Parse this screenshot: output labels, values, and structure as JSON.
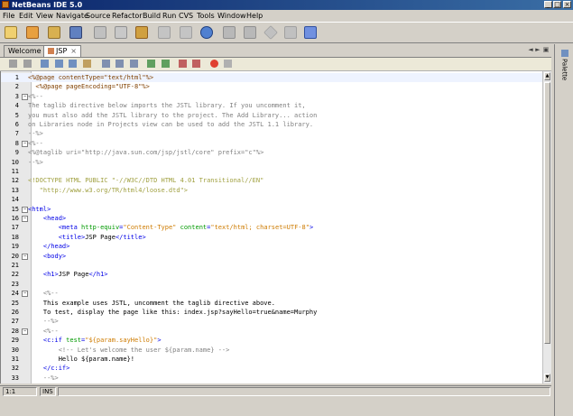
{
  "window": {
    "title": "NetBeans IDE 5.0",
    "min": "_",
    "max": "□",
    "close": "×"
  },
  "menu": [
    "File",
    "Edit",
    "View",
    "Navigate",
    "Source",
    "Refactor",
    "Build",
    "Run",
    "CVS",
    "Tools",
    "Window",
    "Help"
  ],
  "toolbar_icons": [
    {
      "name": "new-file-icon",
      "color": "#e8c060"
    },
    {
      "name": "new-project-icon",
      "color": "#e8a040"
    },
    {
      "name": "open-project-icon",
      "color": "#d8b050"
    },
    {
      "name": "save-all-icon",
      "color": "#6080c0"
    },
    {
      "name": "cut-icon",
      "color": "#a0a0a0"
    },
    {
      "name": "copy-icon",
      "color": "#a0a0a0"
    },
    {
      "name": "paste-icon",
      "color": "#d0a040"
    },
    {
      "name": "undo-icon",
      "color": "#b0b0b0"
    },
    {
      "name": "redo-icon",
      "color": "#b0b0b0"
    },
    {
      "name": "find-icon",
      "color": "#4070c0"
    },
    {
      "name": "build-icon",
      "color": "#a0a0a0"
    },
    {
      "name": "clean-build-icon",
      "color": "#a0a0a0"
    },
    {
      "name": "run-icon",
      "color": "#b0b0b0"
    },
    {
      "name": "debug-icon",
      "color": "#b0b0b0"
    },
    {
      "name": "run-file-icon",
      "color": "#6080e0"
    }
  ],
  "tabs": [
    {
      "label": "Welcome",
      "active": false
    },
    {
      "label": "JSP",
      "active": true
    }
  ],
  "right_panel": {
    "label": "Palette"
  },
  "code_lines": [
    {
      "n": "1",
      "fold": "",
      "segments": [
        {
          "c": "c-directive",
          "t": "<%@page contentType=\"text/html\"%>"
        }
      ]
    },
    {
      "n": "2",
      "fold": "",
      "segments": [
        {
          "c": "c-directive",
          "t": "  <%@page pageEncoding=\"UTF-8\"%>"
        }
      ]
    },
    {
      "n": "3",
      "fold": "−",
      "segments": [
        {
          "c": "c-comment",
          "t": "<%--"
        }
      ]
    },
    {
      "n": "4",
      "fold": "",
      "segments": [
        {
          "c": "c-comment",
          "t": "The taglib directive below imports the JSTL library. If you uncomment it,"
        }
      ]
    },
    {
      "n": "5",
      "fold": "",
      "segments": [
        {
          "c": "c-comment",
          "t": "you must also add the JSTL library to the project. The Add Library... action"
        }
      ]
    },
    {
      "n": "6",
      "fold": "",
      "segments": [
        {
          "c": "c-comment",
          "t": "on Libraries node in Projects view can be used to add the JSTL 1.1 library."
        }
      ]
    },
    {
      "n": "7",
      "fold": "",
      "segments": [
        {
          "c": "c-comment",
          "t": "--%>"
        }
      ]
    },
    {
      "n": "8",
      "fold": "−",
      "segments": [
        {
          "c": "c-comment",
          "t": "<%--"
        }
      ]
    },
    {
      "n": "9",
      "fold": "",
      "segments": [
        {
          "c": "c-comment",
          "t": "<%@taglib uri=\"http://java.sun.com/jsp/jstl/core\" prefix=\"c\"%>"
        }
      ]
    },
    {
      "n": "10",
      "fold": "",
      "segments": [
        {
          "c": "c-comment",
          "t": "--%>"
        }
      ]
    },
    {
      "n": "11",
      "fold": "",
      "segments": [
        {
          "c": "c-text",
          "t": ""
        }
      ]
    },
    {
      "n": "12",
      "fold": "",
      "segments": [
        {
          "c": "c-doctype",
          "t": "<!DOCTYPE HTML PUBLIC \"-//W3C//DTD HTML 4.01 Transitional//EN\""
        }
      ]
    },
    {
      "n": "13",
      "fold": "",
      "segments": [
        {
          "c": "c-doctype",
          "t": "   \"http://www.w3.org/TR/html4/loose.dtd\">"
        }
      ]
    },
    {
      "n": "14",
      "fold": "",
      "segments": [
        {
          "c": "c-text",
          "t": ""
        }
      ]
    },
    {
      "n": "15",
      "fold": "−",
      "segments": [
        {
          "c": "c-tag",
          "t": "<html>"
        }
      ]
    },
    {
      "n": "16",
      "fold": "−",
      "segments": [
        {
          "c": "c-tag",
          "t": "    <head>"
        }
      ]
    },
    {
      "n": "17",
      "fold": "",
      "segments": [
        {
          "c": "c-tag",
          "t": "        <meta "
        },
        {
          "c": "c-attr",
          "t": "http-equiv"
        },
        {
          "c": "c-tag",
          "t": "="
        },
        {
          "c": "c-string",
          "t": "\"Content-Type\""
        },
        {
          "c": "c-tag",
          "t": " "
        },
        {
          "c": "c-attr",
          "t": "content"
        },
        {
          "c": "c-tag",
          "t": "="
        },
        {
          "c": "c-string",
          "t": "\"text/html; charset=UTF-8\""
        },
        {
          "c": "c-tag",
          "t": ">"
        }
      ]
    },
    {
      "n": "18",
      "fold": "",
      "segments": [
        {
          "c": "c-tag",
          "t": "        <title>"
        },
        {
          "c": "c-text",
          "t": "JSP Page"
        },
        {
          "c": "c-tag",
          "t": "</title>"
        }
      ]
    },
    {
      "n": "19",
      "fold": "",
      "segments": [
        {
          "c": "c-tag",
          "t": "    </head>"
        }
      ]
    },
    {
      "n": "20",
      "fold": "−",
      "segments": [
        {
          "c": "c-tag",
          "t": "    <body>"
        }
      ]
    },
    {
      "n": "21",
      "fold": "",
      "segments": [
        {
          "c": "c-text",
          "t": ""
        }
      ]
    },
    {
      "n": "22",
      "fold": "",
      "segments": [
        {
          "c": "c-tag",
          "t": "    <h1>"
        },
        {
          "c": "c-text",
          "t": "JSP Page"
        },
        {
          "c": "c-tag",
          "t": "</h1>"
        }
      ]
    },
    {
      "n": "23",
      "fold": "",
      "segments": [
        {
          "c": "c-text",
          "t": ""
        }
      ]
    },
    {
      "n": "24",
      "fold": "−",
      "segments": [
        {
          "c": "c-comment",
          "t": "    <%--"
        }
      ]
    },
    {
      "n": "25",
      "fold": "",
      "segments": [
        {
          "c": "c-text",
          "t": "    This example uses JSTL, uncomment the taglib directive above."
        }
      ]
    },
    {
      "n": "26",
      "fold": "",
      "segments": [
        {
          "c": "c-text",
          "t": "    To test, display the page like this: index.jsp?sayHello=true&name=Murphy"
        }
      ]
    },
    {
      "n": "27",
      "fold": "",
      "segments": [
        {
          "c": "c-comment",
          "t": "    --%>"
        }
      ]
    },
    {
      "n": "28",
      "fold": "−",
      "segments": [
        {
          "c": "c-comment",
          "t": "    <%--"
        }
      ]
    },
    {
      "n": "29",
      "fold": "",
      "segments": [
        {
          "c": "c-tag",
          "t": "    <c:if "
        },
        {
          "c": "c-attr",
          "t": "test"
        },
        {
          "c": "c-tag",
          "t": "="
        },
        {
          "c": "c-string",
          "t": "\"${param.sayHello}\""
        },
        {
          "c": "c-tag",
          "t": ">"
        }
      ]
    },
    {
      "n": "30",
      "fold": "",
      "segments": [
        {
          "c": "c-comment",
          "t": "        <!-- Let's welcome the user ${param.name} -->"
        }
      ]
    },
    {
      "n": "31",
      "fold": "",
      "segments": [
        {
          "c": "c-text",
          "t": "        Hello ${param.name}!"
        }
      ]
    },
    {
      "n": "32",
      "fold": "",
      "segments": [
        {
          "c": "c-tag",
          "t": "    </c:if>"
        }
      ]
    },
    {
      "n": "33",
      "fold": "",
      "segments": [
        {
          "c": "c-comment",
          "t": "    --%>"
        }
      ]
    }
  ],
  "status": {
    "position": "1:1",
    "mode": "INS"
  }
}
